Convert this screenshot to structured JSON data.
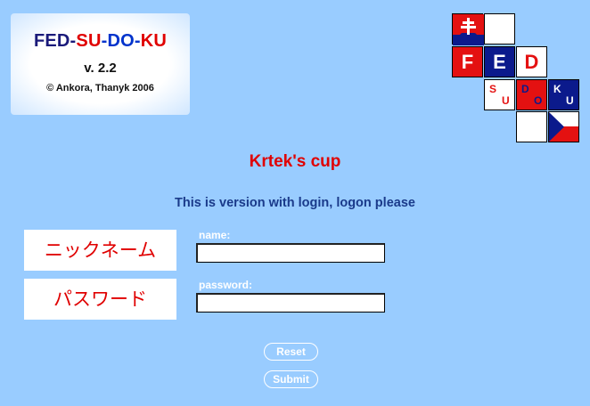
{
  "header": {
    "title_parts": [
      {
        "text": "FED-",
        "color": "#1a1a7a"
      },
      {
        "text": "SU",
        "color": "#e00000"
      },
      {
        "text": "-DO-",
        "color": "#0033cc"
      },
      {
        "text": "KU",
        "color": "#e00000"
      }
    ],
    "version": "v. 2.2",
    "copyright": "© Ankora, Thanyk 2006"
  },
  "logo": {
    "letters": [
      "F",
      "E",
      "D",
      "S",
      "U",
      "D",
      "O",
      "K",
      "U"
    ],
    "colors": {
      "red": "#e41111",
      "blue": "#0b1a8c",
      "white": "#ffffff"
    }
  },
  "main": {
    "cup_title": "Krtek's cup",
    "instruction": "This is version with login, logon please"
  },
  "form": {
    "name_jp": "ニックネーム",
    "name_label": "name:",
    "name_value": "",
    "password_jp": "パスワード",
    "password_label": "password:",
    "password_value": "",
    "reset_label": "Reset",
    "submit_label": "Submit"
  }
}
